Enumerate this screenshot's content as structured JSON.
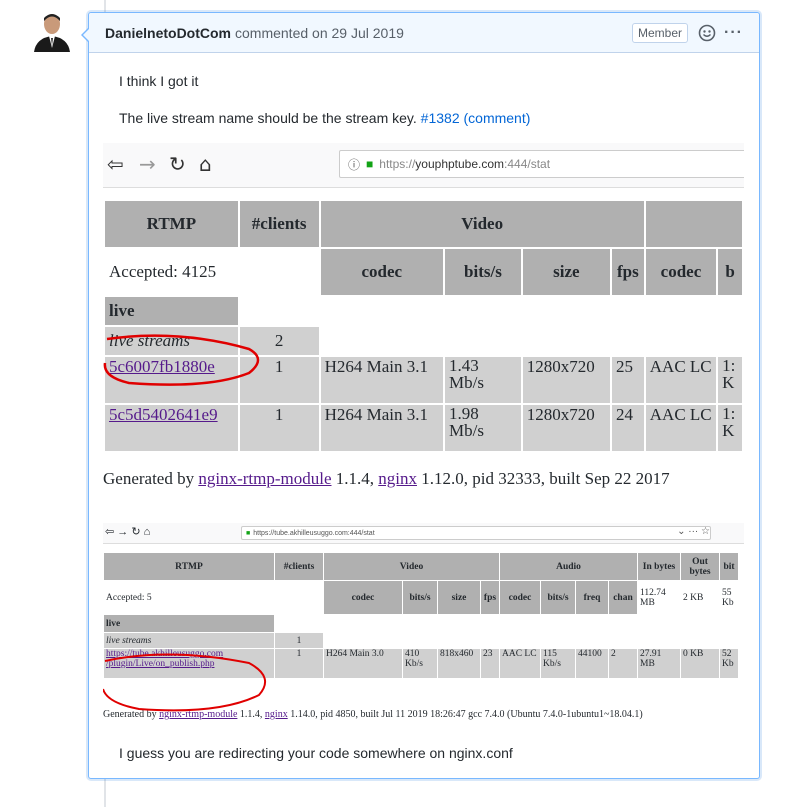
{
  "comment": {
    "author": "DanielnetoDotCom",
    "meta": "commented on 29 Jul 2019",
    "badge": "Member",
    "p1": "I think I got it",
    "p2_text": "The live stream name should be the stream key.",
    "p2_link": "#1382 (comment)",
    "p3": "I guess you are redirecting your code somewhere on nginx.conf"
  },
  "shot1": {
    "url_prefix": "https://",
    "url_host": "youphptube.com",
    "url_rest": ":444/stat",
    "headers": {
      "rtmp": "RTMP",
      "clients": "#clients",
      "video": "Video"
    },
    "accepted": "Accepted: 4125",
    "subheaders": [
      "codec",
      "bits/s",
      "size",
      "fps",
      "codec",
      "b"
    ],
    "live": "live",
    "live_streams": "live streams",
    "live_count": "2",
    "rows": [
      {
        "name": "5c6007fb1880e",
        "clients": "1",
        "codec": "H264 Main 3.1",
        "bits1": "1.43",
        "bits2": "Mb/s",
        "size": "1280x720",
        "fps": "25",
        "acodec": "AAC LC",
        "rest1": "1:",
        "rest2": "K"
      },
      {
        "name": "5c5d5402641e9",
        "clients": "1",
        "codec": "H264 Main 3.1",
        "bits1": "1.98",
        "bits2": "Mb/s",
        "size": "1280x720",
        "fps": "24",
        "acodec": "AAC LC",
        "rest1": "1:",
        "rest2": "K"
      }
    ],
    "footer": {
      "pre": "Generated by ",
      "mod": "nginx-rtmp-module",
      "mid": " 1.1.4, ",
      "ngx": "nginx",
      "post": " 1.12.0, pid 32333, built Sep 22 2017"
    }
  },
  "shot2": {
    "url": "https://tube.akhilleusuggo.com:444/stat",
    "headers": {
      "rtmp": "RTMP",
      "clients": "#clients",
      "video": "Video",
      "audio": "Audio",
      "inbytes": "In bytes",
      "outbytes": "Out bytes",
      "bits": "bit"
    },
    "accepted": "Accepted: 5",
    "inbytes": "112.74 MB",
    "outbytes": "2 KB",
    "bitsrest": "55 Kb",
    "subheaders": [
      "codec",
      "bits/s",
      "size",
      "fps",
      "codec",
      "bits/s",
      "freq",
      "chan"
    ],
    "live": "live",
    "live_streams": "live streams",
    "live_count": "1",
    "row": {
      "name1": "https://tube.akhilleusuggo.com",
      "name2": "/plugin/Live/on_publish.php",
      "clients": "1",
      "codec": "H264 Main 3.0",
      "bits1": "410",
      "bits2": "Kb/s",
      "size": "818x460",
      "fps": "23",
      "acodec": "AAC LC",
      "abits1": "115",
      "abits2": "Kb/s",
      "freq": "44100",
      "chan": "2",
      "inb": "27.91 MB",
      "outb": "0 KB",
      "rest": "52 Kb"
    },
    "footer": {
      "pre": "Generated by ",
      "mod": "nginx-rtmp-module",
      "mid": " 1.1.4, ",
      "ngx": "nginx",
      "post": " 1.14.0, pid 4850, built Jul 11 2019 18:26:47 gcc 7.4.0 (Ubuntu 7.4.0-1ubuntu1~18.04.1)"
    }
  },
  "colors": {
    "link": "#0366d6",
    "header_bg": "#f1f8ff",
    "border": "#79b8ff",
    "annotation": "#e00000"
  }
}
